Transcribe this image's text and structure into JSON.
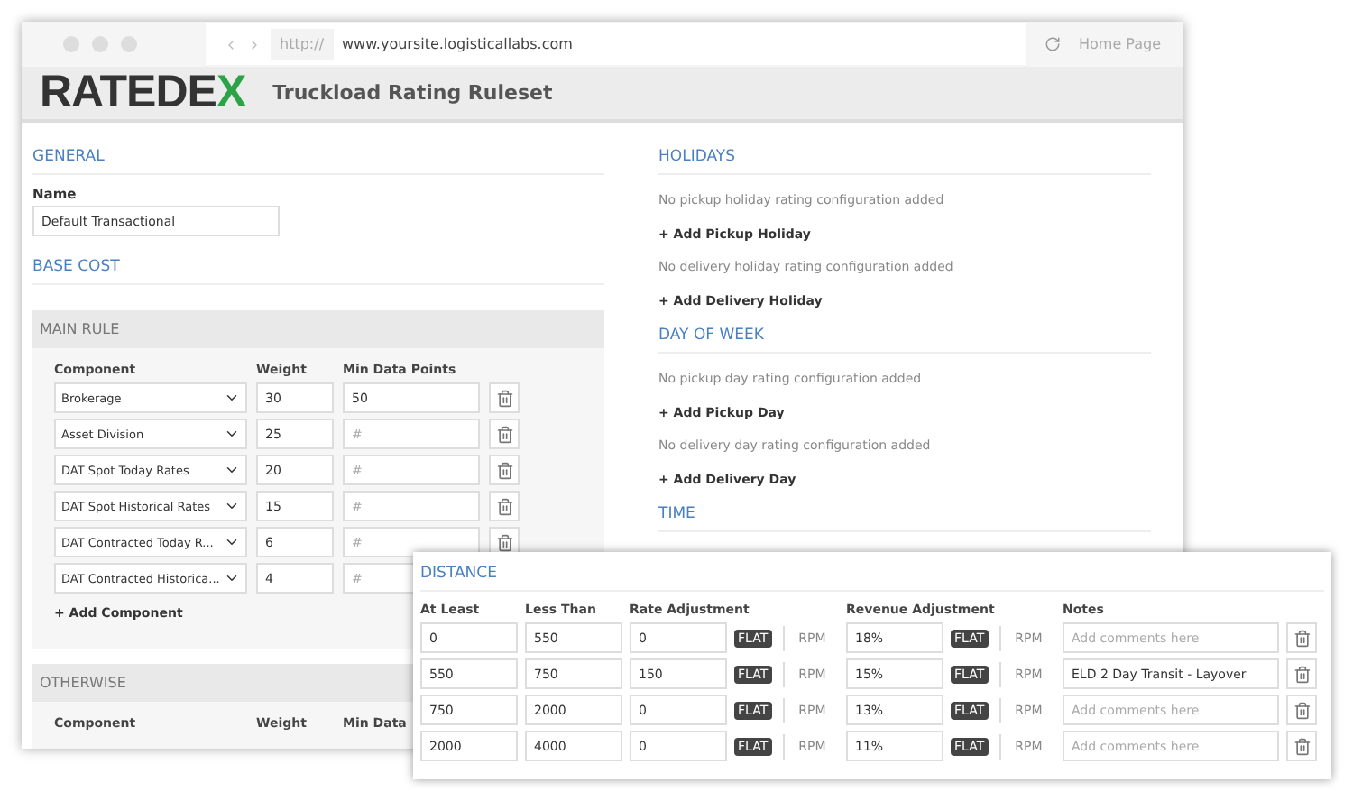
{
  "browser": {
    "protocol": "http://",
    "url": "www.yoursite.logisticallabs.com",
    "home": "Home Page"
  },
  "header": {
    "logo": "RATEDEX",
    "title": "Truckload Rating Ruleset"
  },
  "general": {
    "heading": "GENERAL",
    "name_label": "Name",
    "name_value": "Default Transactional"
  },
  "base_cost": {
    "heading": "BASE COST",
    "main_rule": {
      "heading": "MAIN RULE",
      "columns": [
        "Component",
        "Weight",
        "Min Data Points"
      ],
      "rows": [
        {
          "component": "Brokerage",
          "weight": "30",
          "min_points": "50"
        },
        {
          "component": "Asset Division",
          "weight": "25",
          "placeholder": "#"
        },
        {
          "component": "DAT Spot Today Rates",
          "weight": "20",
          "placeholder": "#"
        },
        {
          "component": "DAT Spot Historical Rates",
          "weight": "15",
          "placeholder": "#"
        },
        {
          "component": "DAT Contracted Today R...",
          "weight": "6",
          "placeholder": "#"
        },
        {
          "component": "DAT Contracted Historica...",
          "weight": "4",
          "placeholder": "#"
        }
      ],
      "add": "+ Add Component"
    },
    "otherwise": {
      "heading": "OTHERWISE",
      "columns": [
        "Component",
        "Weight",
        "Min Data"
      ]
    }
  },
  "holidays": {
    "heading": "HOLIDAYS",
    "items": [
      {
        "note": "No pickup holiday rating configuration added",
        "add": "+ Add Pickup Holiday"
      },
      {
        "note": "No delivery holiday rating configuration added",
        "add": "+ Add Delivery Holiday"
      }
    ]
  },
  "day_of_week": {
    "heading": "DAY OF WEEK",
    "items": [
      {
        "note": "No pickup day rating configuration added",
        "add": "+ Add Pickup Day"
      },
      {
        "note": "No delivery day rating configuration added",
        "add": "+ Add Delivery Day"
      }
    ]
  },
  "time": {
    "heading": "TIME"
  },
  "distance": {
    "heading": "DISTANCE",
    "columns": [
      "At Least",
      "Less Than",
      "Rate Adjustment",
      "Revenue Adjustment",
      "Notes"
    ],
    "rows": [
      {
        "at_least": "0",
        "less_than": "550",
        "rate": "0",
        "rate_units": [
          {
            "label": "FLAT",
            "selected": true
          },
          {
            "label": "RPM",
            "selected": false
          }
        ],
        "revenue": "18%",
        "revenue_units": [
          {
            "label": "FLAT",
            "selected": true
          },
          {
            "label": "RPM",
            "selected": false
          }
        ],
        "notes_placeholder": "Add comments here"
      },
      {
        "at_least": "550",
        "less_than": "750",
        "rate": "150",
        "rate_units": [
          {
            "label": "FLAT",
            "selected": true
          },
          {
            "label": "RPM",
            "selected": false
          }
        ],
        "revenue": "15%",
        "revenue_units": [
          {
            "label": "FLAT",
            "selected": true
          },
          {
            "label": "RPM",
            "selected": false
          }
        ],
        "notes": "ELD 2 Day Transit - Layover"
      },
      {
        "at_least": "750",
        "less_than": "2000",
        "rate": "0",
        "rate_units": [
          {
            "label": "FLAT",
            "selected": true
          },
          {
            "label": "RPM",
            "selected": false
          }
        ],
        "revenue": "13%",
        "revenue_units": [
          {
            "label": "FLAT",
            "selected": true
          },
          {
            "label": "RPM",
            "selected": false
          }
        ],
        "notes_placeholder": "Add comments here"
      },
      {
        "at_least": "2000",
        "less_than": "4000",
        "rate": "0",
        "rate_units": [
          {
            "label": "FLAT",
            "selected": true
          },
          {
            "label": "RPM",
            "selected": false
          }
        ],
        "revenue": "11%",
        "revenue_units": [
          {
            "label": "FLAT",
            "selected": true
          },
          {
            "label": "RPM",
            "selected": false
          }
        ],
        "notes_placeholder": "Add comments here"
      }
    ]
  }
}
